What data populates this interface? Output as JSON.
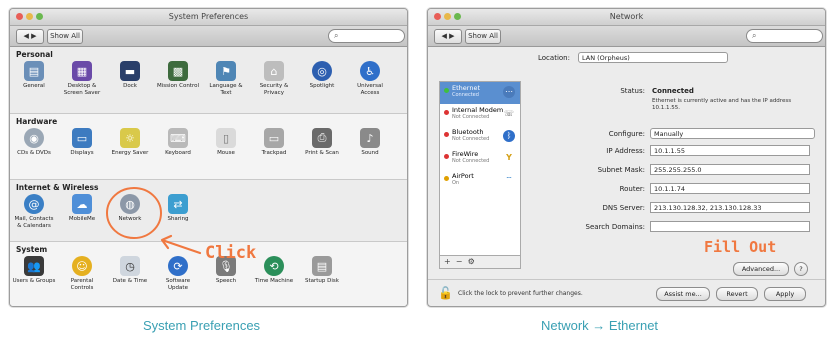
{
  "left": {
    "title": "System Preferences",
    "show_all": "Show All",
    "sections": [
      {
        "title": "Personal",
        "items": [
          "General",
          "Desktop & Screen Saver",
          "Dock",
          "Mission Control",
          "Language & Text",
          "Security & Privacy",
          "Spotlight",
          "Universal Access"
        ]
      },
      {
        "title": "Hardware",
        "items": [
          "CDs & DVDs",
          "Displays",
          "Energy Saver",
          "Keyboard",
          "Mouse",
          "Trackpad",
          "Print & Scan",
          "Sound"
        ]
      },
      {
        "title": "Internet & Wireless",
        "items": [
          "Mail, Contacts & Calendars",
          "MobileMe",
          "Network",
          "Sharing"
        ]
      },
      {
        "title": "System",
        "items": [
          "Users & Groups",
          "Parental Controls",
          "Date & Time",
          "Software Update",
          "Speech",
          "Time Machine",
          "Startup Disk"
        ]
      }
    ],
    "annotation": "Click",
    "caption": "System Preferences"
  },
  "right": {
    "title": "Network",
    "show_all": "Show All",
    "location_label": "Location:",
    "location_value": "LAN (Orpheus)",
    "services": [
      {
        "name": "Ethernet",
        "status": "Connected",
        "color": "#3fbf3f",
        "icon": "ethernet-icon"
      },
      {
        "name": "Internal Modem",
        "status": "Not Connected",
        "color": "#d33",
        "icon": "phone-icon"
      },
      {
        "name": "Bluetooth",
        "status": "Not Connected",
        "color": "#d33",
        "icon": "bluetooth-icon"
      },
      {
        "name": "FireWire",
        "status": "Not Connected",
        "color": "#d33",
        "icon": "firewire-icon"
      },
      {
        "name": "AirPort",
        "status": "On",
        "color": "#e0a000",
        "icon": "wifi-icon"
      }
    ],
    "status_label": "Status:",
    "status_value": "Connected",
    "status_desc": "Ethernet is currently active and has the IP address 10.1.1.55.",
    "configure_label": "Configure:",
    "configure_value": "Manually",
    "ip_label": "IP Address:",
    "ip_value": "10.1.1.55",
    "mask_label": "Subnet Mask:",
    "mask_value": "255.255.255.0",
    "router_label": "Router:",
    "router_value": "10.1.1.74",
    "dns_label": "DNS Server:",
    "dns_value": "213.130.128.32, 213.130.128.33",
    "search_label": "Search Domains:",
    "search_value": "",
    "advanced": "Advanced...",
    "help": "?",
    "lock_text": "Click the lock to prevent further changes.",
    "assist": "Assist me...",
    "revert": "Revert",
    "apply": "Apply",
    "annotation": "Fill Out",
    "caption": "Network → Ethernet"
  }
}
